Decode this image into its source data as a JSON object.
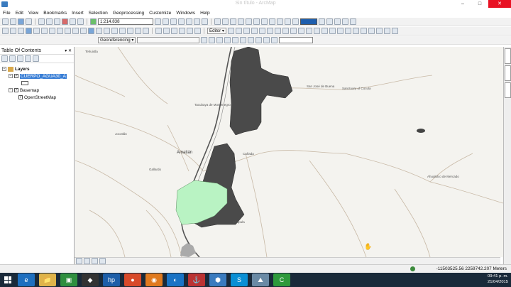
{
  "window": {
    "title": "Sin título - ArcMap",
    "controls": [
      "–",
      "□",
      "✕"
    ]
  },
  "menu": [
    "File",
    "Edit",
    "View",
    "Bookmarks",
    "Insert",
    "Selection",
    "Geoprocessing",
    "Customize",
    "Windows",
    "Help"
  ],
  "toolbar": {
    "scale": "1:214.838",
    "editor_label": "Editor ▾",
    "georeferencing_label": "Georeferencing ▾"
  },
  "toc": {
    "title": "Table Of Contents",
    "root": "Layers",
    "layers": [
      {
        "name": "CUERPO_AGUA30_A",
        "checked": true,
        "selected": true
      },
      {
        "name": "Basemap",
        "checked": true
      },
      {
        "name": "OpenStreetMap",
        "checked": true
      }
    ]
  },
  "map": {
    "places": [
      "Amatlán",
      "Tacubaya de Montenegro",
      "San José de Buena",
      "Sanctuary of Cocula",
      "Jocotlán",
      "Cañada",
      "Gallardo",
      "Ahualulco de Mercado",
      "Chapula",
      "Tehuixtla"
    ],
    "colors": {
      "background": "#f4f3ef",
      "water_dark": "#4a4a4a",
      "water_light": "#b9f3c3",
      "roads": "#c8b9a6"
    }
  },
  "status": {
    "coordinates": "-11503525.56  2259742.207 Meters"
  },
  "taskbar": {
    "apps": [
      "e",
      "📁",
      "▣",
      "◆",
      "hp",
      "●",
      "◉",
      "◐",
      "⚓",
      "⬢",
      "S",
      "⛰",
      "C"
    ],
    "time": "09:41 p. m.",
    "date": "21/04/2015"
  }
}
